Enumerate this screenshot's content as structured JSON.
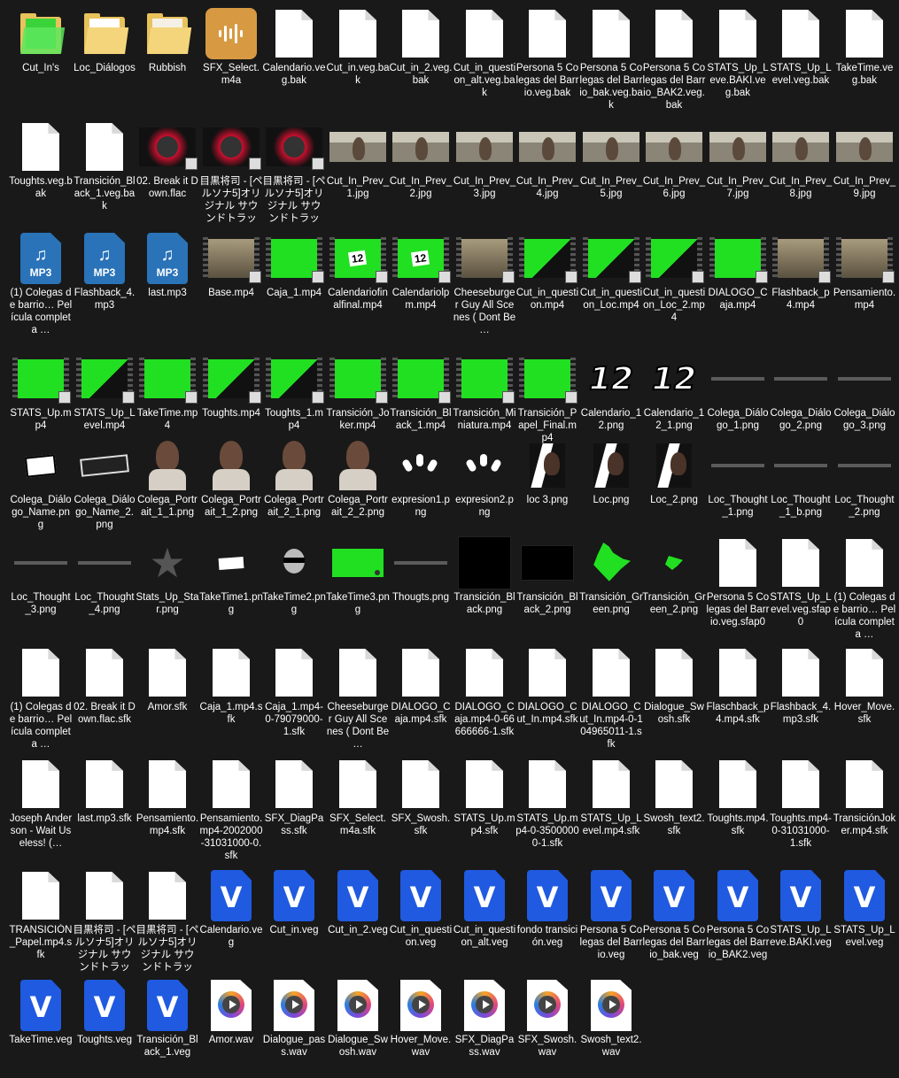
{
  "files": [
    {
      "name": "Cut_In's",
      "icon": "folder-icon",
      "thumb": "folder-green"
    },
    {
      "name": "Loc_Diálogos",
      "icon": "folder-icon",
      "thumb": "folder-doc"
    },
    {
      "name": "Rubbish",
      "icon": "folder-icon",
      "thumb": "folder-paper"
    },
    {
      "name": "SFX_Select.m4a",
      "icon": "m4a-audio-icon",
      "thumb": "m4a"
    },
    {
      "name": "Calendario.veg.bak",
      "icon": "blank-file-icon",
      "thumb": "doc"
    },
    {
      "name": "Cut_in.veg.bak",
      "icon": "blank-file-icon",
      "thumb": "doc"
    },
    {
      "name": "Cut_in_2.veg.bak",
      "icon": "blank-file-icon",
      "thumb": "doc"
    },
    {
      "name": "Cut_in_question_alt.veg.bak",
      "icon": "blank-file-icon",
      "thumb": "doc"
    },
    {
      "name": "Persona 5 Colegas del Barrio.veg.bak",
      "icon": "blank-file-icon",
      "thumb": "doc"
    },
    {
      "name": "Persona 5 Colegas del Barrio_bak.veg.bak",
      "icon": "blank-file-icon",
      "thumb": "doc"
    },
    {
      "name": "Persona 5 Colegas del Barrio_BAK2.veg.bak",
      "icon": "blank-file-icon",
      "thumb": "doc"
    },
    {
      "name": "STATS_Up_Leve.BAKI.veg.bak",
      "icon": "blank-file-icon",
      "thumb": "doc"
    },
    {
      "name": "STATS_Up_Level.veg.bak",
      "icon": "blank-file-icon",
      "thumb": "doc"
    },
    {
      "name": "TakeTime.veg.bak",
      "icon": "blank-file-icon",
      "thumb": "doc"
    },
    {
      "name": "Toughts.veg.bak",
      "icon": "blank-file-icon",
      "thumb": "doc"
    },
    {
      "name": "Transición_Black_1.veg.bak",
      "icon": "blank-file-icon",
      "thumb": "doc"
    },
    {
      "name": "02. Break it Down.flac",
      "icon": "album-art-icon",
      "thumb": "album"
    },
    {
      "name": "目黒将司 - [ペルソナ5]オリジナル サウンドトラック…",
      "icon": "album-art-icon",
      "thumb": "album"
    },
    {
      "name": "目黒将司 - [ペルソナ5]オリジナル サウンドトラック…",
      "icon": "album-art-icon",
      "thumb": "album"
    },
    {
      "name": "Cut_In_Prev_1.jpg",
      "icon": "image-thumbnail-icon",
      "thumb": "scene"
    },
    {
      "name": "Cut_In_Prev_2.jpg",
      "icon": "image-thumbnail-icon",
      "thumb": "scene"
    },
    {
      "name": "Cut_In_Prev_3.jpg",
      "icon": "image-thumbnail-icon",
      "thumb": "scene"
    },
    {
      "name": "Cut_In_Prev_4.jpg",
      "icon": "image-thumbnail-icon",
      "thumb": "scene"
    },
    {
      "name": "Cut_In_Prev_5.jpg",
      "icon": "image-thumbnail-icon",
      "thumb": "scene"
    },
    {
      "name": "Cut_In_Prev_6.jpg",
      "icon": "image-thumbnail-icon",
      "thumb": "scene"
    },
    {
      "name": "Cut_In_Prev_7.jpg",
      "icon": "image-thumbnail-icon",
      "thumb": "scene"
    },
    {
      "name": "Cut_In_Prev_8.jpg",
      "icon": "image-thumbnail-icon",
      "thumb": "scene"
    },
    {
      "name": "Cut_In_Prev_9.jpg",
      "icon": "image-thumbnail-icon",
      "thumb": "scene"
    },
    {
      "name": "(1) Colegas de barrio… Película completa …",
      "icon": "mp3-file-icon",
      "thumb": "mp3"
    },
    {
      "name": "Flashback_4.mp3",
      "icon": "mp3-file-icon",
      "thumb": "mp3"
    },
    {
      "name": "last.mp3",
      "icon": "mp3-file-icon",
      "thumb": "mp3"
    },
    {
      "name": "Base.mp4",
      "icon": "video-thumbnail-icon",
      "thumb": "vid-scene"
    },
    {
      "name": "Caja_1.mp4",
      "icon": "video-thumbnail-icon",
      "thumb": "vid-green"
    },
    {
      "name": "Calendariofinalfinal.mp4",
      "icon": "video-thumbnail-icon",
      "thumb": "vid-cal"
    },
    {
      "name": "Calendariolpm.mp4",
      "icon": "video-thumbnail-icon",
      "thumb": "vid-cal"
    },
    {
      "name": "Cheeseburger Guy All Scenes ( Dont Be …",
      "icon": "video-thumbnail-icon",
      "thumb": "vid-scene"
    },
    {
      "name": "Cut_in_question.mp4",
      "icon": "video-thumbnail-icon",
      "thumb": "vid-greenblack"
    },
    {
      "name": "Cut_in_question_Loc.mp4",
      "icon": "video-thumbnail-icon",
      "thumb": "vid-greenblack"
    },
    {
      "name": "Cut_in_question_Loc_2.mp4",
      "icon": "video-thumbnail-icon",
      "thumb": "vid-greenblack"
    },
    {
      "name": "DIALOGO_Caja.mp4",
      "icon": "video-thumbnail-icon",
      "thumb": "vid-green"
    },
    {
      "name": "Flashback_p4.mp4",
      "icon": "video-thumbnail-icon",
      "thumb": "vid-scene"
    },
    {
      "name": "Pensamiento.mp4",
      "icon": "video-thumbnail-icon",
      "thumb": "vid-scene"
    },
    {
      "name": "STATS_Up.mp4",
      "icon": "video-thumbnail-icon",
      "thumb": "vid-green"
    },
    {
      "name": "STATS_Up_Level.mp4",
      "icon": "video-thumbnail-icon",
      "thumb": "vid-greenblack"
    },
    {
      "name": "TakeTime.mp4",
      "icon": "video-thumbnail-icon",
      "thumb": "vid-green"
    },
    {
      "name": "Toughts.mp4",
      "icon": "video-thumbnail-icon",
      "thumb": "vid-greenblack"
    },
    {
      "name": "Toughts_1.mp4",
      "icon": "video-thumbnail-icon",
      "thumb": "vid-greenblack"
    },
    {
      "name": "Transición_Joker.mp4",
      "icon": "video-thumbnail-icon",
      "thumb": "vid-green"
    },
    {
      "name": "Transición_Black_1.mp4",
      "icon": "video-thumbnail-icon",
      "thumb": "vid-green"
    },
    {
      "name": "Transición_Miniatura.mp4",
      "icon": "video-thumbnail-icon",
      "thumb": "vid-green"
    },
    {
      "name": "Transición_Papel_Final.mp4",
      "icon": "video-thumbnail-icon",
      "thumb": "vid-green"
    },
    {
      "name": "Calendario_12.png",
      "icon": "image-thumbnail-icon",
      "thumb": "num12"
    },
    {
      "name": "Calendario_12_1.png",
      "icon": "image-thumbnail-icon",
      "thumb": "num12"
    },
    {
      "name": "Colega_Diálogo_1.png",
      "icon": "image-thumbnail-icon",
      "thumb": "textline"
    },
    {
      "name": "Colega_Diálogo_2.png",
      "icon": "image-thumbnail-icon",
      "thumb": "textline"
    },
    {
      "name": "Colega_Diálogo_3.png",
      "icon": "image-thumbnail-icon",
      "thumb": "textline"
    },
    {
      "name": "Colega_Diálogo_Name.png",
      "icon": "image-thumbnail-icon",
      "thumb": "namebox"
    },
    {
      "name": "Colega_Diálogo_Name_2.png",
      "icon": "image-thumbnail-icon",
      "thumb": "namebox-dark"
    },
    {
      "name": "Colega_Portrait_1_1.png",
      "icon": "image-thumbnail-icon",
      "thumb": "portrait"
    },
    {
      "name": "Colega_Portrait_1_2.png",
      "icon": "image-thumbnail-icon",
      "thumb": "portrait"
    },
    {
      "name": "Colega_Portrait_2_1.png",
      "icon": "image-thumbnail-icon",
      "thumb": "portrait"
    },
    {
      "name": "Colega_Portrait_2_2.png",
      "icon": "image-thumbnail-icon",
      "thumb": "portrait"
    },
    {
      "name": "expresion1.png",
      "icon": "image-thumbnail-icon",
      "thumb": "expr"
    },
    {
      "name": "expresion2.png",
      "icon": "image-thumbnail-icon",
      "thumb": "expr"
    },
    {
      "name": "loc 3.png",
      "icon": "image-thumbnail-icon",
      "thumb": "loc"
    },
    {
      "name": "Loc.png",
      "icon": "image-thumbnail-icon",
      "thumb": "loc"
    },
    {
      "name": "Loc_2.png",
      "icon": "image-thumbnail-icon",
      "thumb": "loc"
    },
    {
      "name": "Loc_Thought_1.png",
      "icon": "image-thumbnail-icon",
      "thumb": "textline"
    },
    {
      "name": "Loc_Thought_1_b.png",
      "icon": "image-thumbnail-icon",
      "thumb": "textline"
    },
    {
      "name": "Loc_Thought_2.png",
      "icon": "image-thumbnail-icon",
      "thumb": "textline"
    },
    {
      "name": "Loc_Thought_3.png",
      "icon": "image-thumbnail-icon",
      "thumb": "textline"
    },
    {
      "name": "Loc_Thought_4.png",
      "icon": "image-thumbnail-icon",
      "thumb": "textline"
    },
    {
      "name": "Stats_Up_Star.png",
      "icon": "image-thumbnail-icon",
      "thumb": "star"
    },
    {
      "name": "TakeTime1.png",
      "icon": "image-thumbnail-icon",
      "thumb": "taketime"
    },
    {
      "name": "TakeTime2.png",
      "icon": "image-thumbnail-icon",
      "thumb": "sunglasses"
    },
    {
      "name": "TakeTime3.png",
      "icon": "image-thumbnail-icon",
      "thumb": "greenimg"
    },
    {
      "name": "Thougts.png",
      "icon": "image-thumbnail-icon",
      "thumb": "textline"
    },
    {
      "name": "Transición_Black.png",
      "icon": "image-thumbnail-icon",
      "thumb": "blackimg"
    },
    {
      "name": "Transición_Black_2.png",
      "icon": "image-thumbnail-icon",
      "thumb": "blackimg2"
    },
    {
      "name": "Transición_Green.png",
      "icon": "image-thumbnail-icon",
      "thumb": "greenshape"
    },
    {
      "name": "Transición_Green_2.png",
      "icon": "image-thumbnail-icon",
      "thumb": "greenshape2"
    },
    {
      "name": "Persona 5 Colegas del Barrio.veg.sfap0",
      "icon": "blank-file-icon",
      "thumb": "doc"
    },
    {
      "name": "STATS_Up_Level.veg.sfap0",
      "icon": "blank-file-icon",
      "thumb": "doc"
    },
    {
      "name": "(1) Colegas de barrio… Película completa …",
      "icon": "blank-file-icon",
      "thumb": "doc"
    },
    {
      "name": "(1) Colegas de barrio… Película completa …",
      "icon": "blank-file-icon",
      "thumb": "doc"
    },
    {
      "name": "02. Break it Down.flac.sfk",
      "icon": "blank-file-icon",
      "thumb": "doc"
    },
    {
      "name": "Amor.sfk",
      "icon": "blank-file-icon",
      "thumb": "doc"
    },
    {
      "name": "Caja_1.mp4.sfk",
      "icon": "blank-file-icon",
      "thumb": "doc"
    },
    {
      "name": "Caja_1.mp4-0-79079000-1.sfk",
      "icon": "blank-file-icon",
      "thumb": "doc"
    },
    {
      "name": "Cheeseburger Guy All Scenes ( Dont Be …",
      "icon": "blank-file-icon",
      "thumb": "doc"
    },
    {
      "name": "DIALOGO_Caja.mp4.sfk",
      "icon": "blank-file-icon",
      "thumb": "doc"
    },
    {
      "name": "DIALOGO_Caja.mp4-0-66666666-1.sfk",
      "icon": "blank-file-icon",
      "thumb": "doc"
    },
    {
      "name": "DIALOGO_Cut_In.mp4.sfk",
      "icon": "blank-file-icon",
      "thumb": "doc"
    },
    {
      "name": "DIALOGO_Cut_In.mp4-0-104965011-1.sfk",
      "icon": "blank-file-icon",
      "thumb": "doc"
    },
    {
      "name": "Dialogue_Swosh.sfk",
      "icon": "blank-file-icon",
      "thumb": "doc"
    },
    {
      "name": "Flaschback_p4.mp4.sfk",
      "icon": "blank-file-icon",
      "thumb": "doc"
    },
    {
      "name": "Flashback_4.mp3.sfk",
      "icon": "blank-file-icon",
      "thumb": "doc"
    },
    {
      "name": "Hover_Move.sfk",
      "icon": "blank-file-icon",
      "thumb": "doc"
    },
    {
      "name": "Joseph Anderson - Wait Useless! (…",
      "icon": "blank-file-icon",
      "thumb": "doc"
    },
    {
      "name": "last.mp3.sfk",
      "icon": "blank-file-icon",
      "thumb": "doc"
    },
    {
      "name": "Pensamiento.mp4.sfk",
      "icon": "blank-file-icon",
      "thumb": "doc"
    },
    {
      "name": "Pensamiento.mp4-2002000-31031000-0.sfk",
      "icon": "blank-file-icon",
      "thumb": "doc"
    },
    {
      "name": "SFX_DiagPass.sfk",
      "icon": "blank-file-icon",
      "thumb": "doc"
    },
    {
      "name": "SFX_Select.m4a.sfk",
      "icon": "blank-file-icon",
      "thumb": "doc"
    },
    {
      "name": "SFX_Swosh.sfk",
      "icon": "blank-file-icon",
      "thumb": "doc"
    },
    {
      "name": "STATS_Up.mp4.sfk",
      "icon": "blank-file-icon",
      "thumb": "doc"
    },
    {
      "name": "STATS_Up.mp4-0-35000000-1.sfk",
      "icon": "blank-file-icon",
      "thumb": "doc"
    },
    {
      "name": "STATS_Up_Level.mp4.sfk",
      "icon": "blank-file-icon",
      "thumb": "doc"
    },
    {
      "name": "Swosh_text2.sfk",
      "icon": "blank-file-icon",
      "thumb": "doc"
    },
    {
      "name": "Toughts.mp4.sfk",
      "icon": "blank-file-icon",
      "thumb": "doc"
    },
    {
      "name": "Toughts.mp4-0-31031000-1.sfk",
      "icon": "blank-file-icon",
      "thumb": "doc"
    },
    {
      "name": "TransiciónJoker.mp4.sfk",
      "icon": "blank-file-icon",
      "thumb": "doc"
    },
    {
      "name": "TRANSICIÓN_Papel.mp4.sfk",
      "icon": "blank-file-icon",
      "thumb": "doc"
    },
    {
      "name": "目黒将司 - [ペルソナ5]オリジナル サウンドトラック…",
      "icon": "blank-file-icon",
      "thumb": "doc"
    },
    {
      "name": "目黒将司 - [ペルソナ5]オリジナル サウンドトラック…",
      "icon": "blank-file-icon",
      "thumb": "doc"
    },
    {
      "name": "Calendario.veg",
      "icon": "vegas-project-icon",
      "thumb": "veg"
    },
    {
      "name": "Cut_in.veg",
      "icon": "vegas-project-icon",
      "thumb": "veg"
    },
    {
      "name": "Cut_in_2.veg",
      "icon": "vegas-project-icon",
      "thumb": "veg"
    },
    {
      "name": "Cut_in_question.veg",
      "icon": "vegas-project-icon",
      "thumb": "veg"
    },
    {
      "name": "Cut_in_question_alt.veg",
      "icon": "vegas-project-icon",
      "thumb": "veg"
    },
    {
      "name": "fondo transición.veg",
      "icon": "vegas-project-icon",
      "thumb": "veg"
    },
    {
      "name": "Persona 5 Colegas del Barrio.veg",
      "icon": "vegas-project-icon",
      "thumb": "veg"
    },
    {
      "name": "Persona 5 Colegas del Barrio_bak.veg",
      "icon": "vegas-project-icon",
      "thumb": "veg"
    },
    {
      "name": "Persona 5 Colegas del Barrio_BAK2.veg",
      "icon": "vegas-project-icon",
      "thumb": "veg"
    },
    {
      "name": "STATS_Up_Leve.BAKI.veg",
      "icon": "vegas-project-icon",
      "thumb": "veg"
    },
    {
      "name": "STATS_Up_Level.veg",
      "icon": "vegas-project-icon",
      "thumb": "veg"
    },
    {
      "name": "TakeTime.veg",
      "icon": "vegas-project-icon",
      "thumb": "veg"
    },
    {
      "name": "Toughts.veg",
      "icon": "vegas-project-icon",
      "thumb": "veg"
    },
    {
      "name": "Transición_Black_1.veg",
      "icon": "vegas-project-icon",
      "thumb": "veg"
    },
    {
      "name": "Amor.wav",
      "icon": "wav-audio-icon",
      "thumb": "wav"
    },
    {
      "name": "Dialogue_pass.wav",
      "icon": "wav-audio-icon",
      "thumb": "wav"
    },
    {
      "name": "Dialogue_Swosh.wav",
      "icon": "wav-audio-icon",
      "thumb": "wav"
    },
    {
      "name": "Hover_Move.wav",
      "icon": "wav-audio-icon",
      "thumb": "wav"
    },
    {
      "name": "SFX_DiagPass.wav",
      "icon": "wav-audio-icon",
      "thumb": "wav"
    },
    {
      "name": "SFX_Swosh.wav",
      "icon": "wav-audio-icon",
      "thumb": "wav"
    },
    {
      "name": "Swosh_text2.wav",
      "icon": "wav-audio-icon",
      "thumb": "wav"
    }
  ]
}
